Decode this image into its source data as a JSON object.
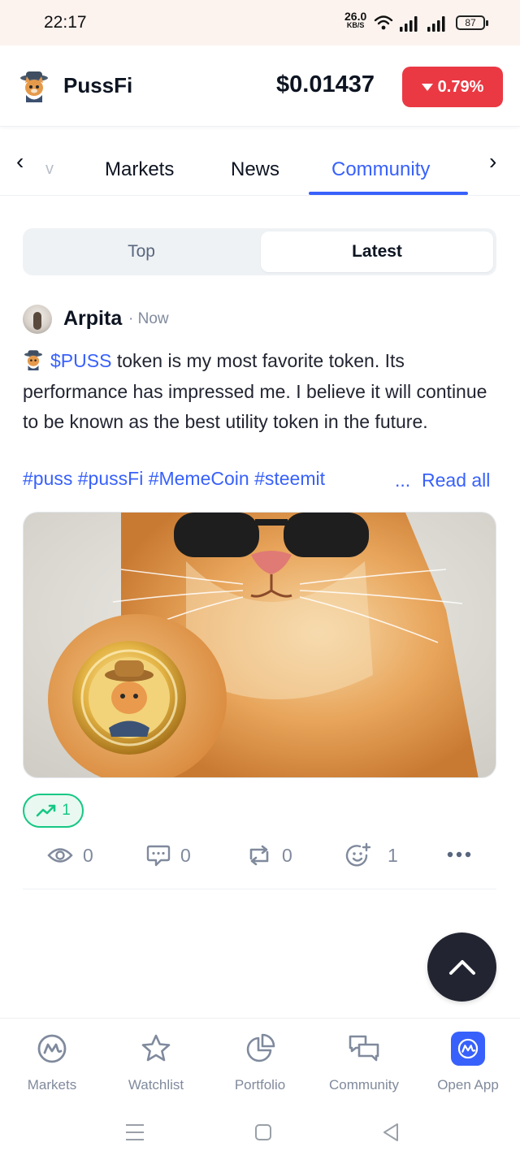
{
  "status_bar": {
    "time": "22:17",
    "net_speed": "26.0",
    "net_unit": "KB/S",
    "battery": "87"
  },
  "header": {
    "coin_name": "PussFi",
    "price": "$0.01437",
    "change": "0.79%",
    "change_color": "#ea3943"
  },
  "tabs": {
    "prev_arrow": "‹",
    "next_arrow": "›",
    "partial": "v",
    "items": [
      "Markets",
      "News",
      "Community"
    ],
    "active": "Community",
    "accent": "#3861fb"
  },
  "segment": {
    "top_label": "Top",
    "latest_label": "Latest",
    "active": "Latest"
  },
  "post": {
    "author": "Arpita",
    "time": "· Now",
    "cashtag": "$PUSS",
    "text": " token is my most favorite token. Its performance has impressed me. I believe it will continue to be known as the best utility token in the future.",
    "hashtags": "#puss #pussFi #MemeCoin #steemit",
    "ellipsis": "...",
    "read_all": "Read all",
    "trend_count": "1",
    "stats": {
      "views": "0",
      "comments": "0",
      "reposts": "0",
      "reactions": "1"
    }
  },
  "bottom_nav": {
    "items": [
      {
        "label": "Markets",
        "icon": "markets-icon"
      },
      {
        "label": "Watchlist",
        "icon": "star-icon"
      },
      {
        "label": "Portfolio",
        "icon": "pie-chart-icon"
      },
      {
        "label": "Community",
        "icon": "chat-bubbles-icon"
      },
      {
        "label": "Open App",
        "icon": "app-logo-icon"
      }
    ]
  }
}
